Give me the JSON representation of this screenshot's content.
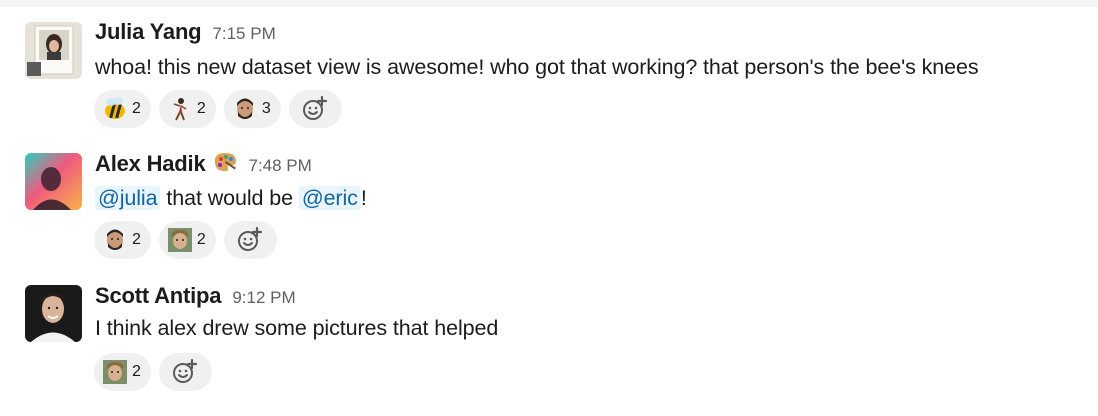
{
  "messages": [
    {
      "author": "Julia Yang",
      "time": "7:15 PM",
      "text": "whoa! this new dataset view is awesome! who got that working? that person's the bee's knees",
      "reactions": [
        {
          "emoji": "bee-emoji",
          "count": "2"
        },
        {
          "emoji": "dancer-emoji",
          "count": "2"
        },
        {
          "emoji": "face-emoji",
          "count": "3"
        }
      ]
    },
    {
      "author": "Alex Hadik",
      "status_emoji": "palette-icon",
      "time": "7:48 PM",
      "mention_1": "@julia",
      "text_middle": " that would be ",
      "mention_2": "@eric",
      "text_end": "!",
      "reactions": [
        {
          "emoji": "face-emoji",
          "count": "2"
        },
        {
          "emoji": "photo-face-emoji",
          "count": "2"
        }
      ]
    },
    {
      "author": "Scott Antipa",
      "time": "9:12 PM",
      "text": "I think alex drew some pictures that helped",
      "reactions": [
        {
          "emoji": "photo-face-emoji",
          "count": "2"
        }
      ]
    }
  ],
  "colors": {
    "mention_bg": "#e8f5fa",
    "mention_text": "#1264a3",
    "reaction_bg": "#f0f0f0",
    "timestamp": "#616061"
  }
}
